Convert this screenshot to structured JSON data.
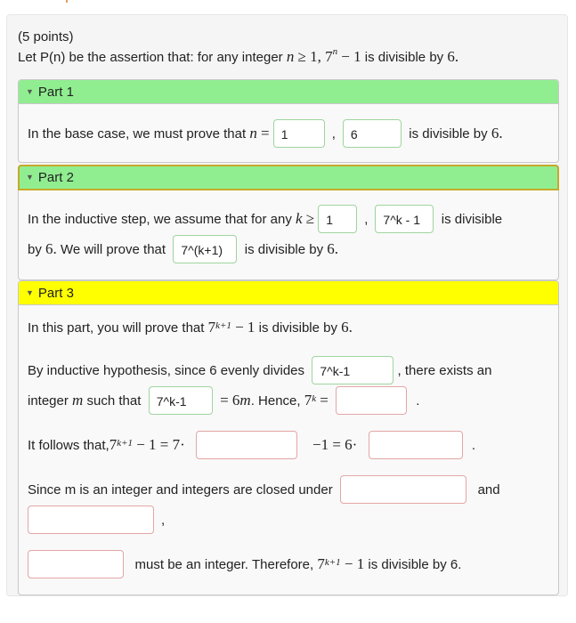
{
  "header": {
    "points": "(5 points)",
    "statement_prefix": "Let P(n) be the assertion that: for any integer",
    "statement_n": "n",
    "statement_geq": "≥ 1, 7",
    "statement_exp": "n",
    "statement_minus": "− 1",
    "statement_suffix": "is divisible by",
    "statement_six": "6."
  },
  "part1": {
    "title": "Part 1",
    "text_prefix": "In the base case, we must prove that",
    "var": "n",
    "eq": "=",
    "input_n": "1",
    "comma": ",",
    "input_expr": "6",
    "text_suffix": "is divisible by",
    "six": "6."
  },
  "part2": {
    "title": "Part 2",
    "text_prefix": "In the inductive step, we assume that for any",
    "var": "k",
    "geq": "≥",
    "input_k": "1",
    "comma": ",",
    "input_hyp": "7^k - 1",
    "text_mid": "is divisible",
    "line2_prefix": "by",
    "six": "6.",
    "line2_mid": "We will prove that",
    "input_goal": "7^(k+1)",
    "line2_suffix": "is divisible by",
    "six_end": "6."
  },
  "part3": {
    "title": "Part 3",
    "intro_prefix": "In this part, you will prove that",
    "intro_base": "7",
    "intro_exp": "k+1",
    "intro_minus": "− 1",
    "intro_suffix": "is divisible by",
    "intro_six": "6.",
    "hyp_prefix": "By inductive hypothesis, since 6 evenly divides",
    "input_divides": "7^k-1",
    "hyp_suffix": ", there exists an",
    "int_prefix": "integer",
    "int_var": "m",
    "int_mid": "such that",
    "input_eq6m": "7^k-1",
    "eq6m": "= 6",
    "eq6m_var": "m",
    "hence": ". Hence,",
    "hence_base": "7",
    "hence_exp": "k",
    "hence_eq": "=",
    "input_7k": "",
    "period": ".",
    "follows_prefix": "It follows that,",
    "follows_base": "7",
    "follows_exp": "k+1",
    "follows_eq": "− 1 = 7·",
    "input_times7": "",
    "follows_mid": "−1 = 6·",
    "input_times6": "",
    "follows_end": ".",
    "closed_prefix": "Since m is an integer and integers are closed under",
    "input_closed1": "",
    "closed_and": "and",
    "input_closed2": "",
    "closed_comma": ",",
    "input_must": "",
    "must_text": "must be an integer. Therefore,",
    "must_base": "7",
    "must_exp": "k+1",
    "must_minus": "− 1",
    "must_suffix": "is divisible by 6."
  },
  "colors": {
    "part_complete": "#90ee90",
    "part_active": "#ffff00",
    "focus_outline": "#c6a92b",
    "filled_box_border": "#9fd49f",
    "empty_box_border": "#e3a6a6"
  }
}
